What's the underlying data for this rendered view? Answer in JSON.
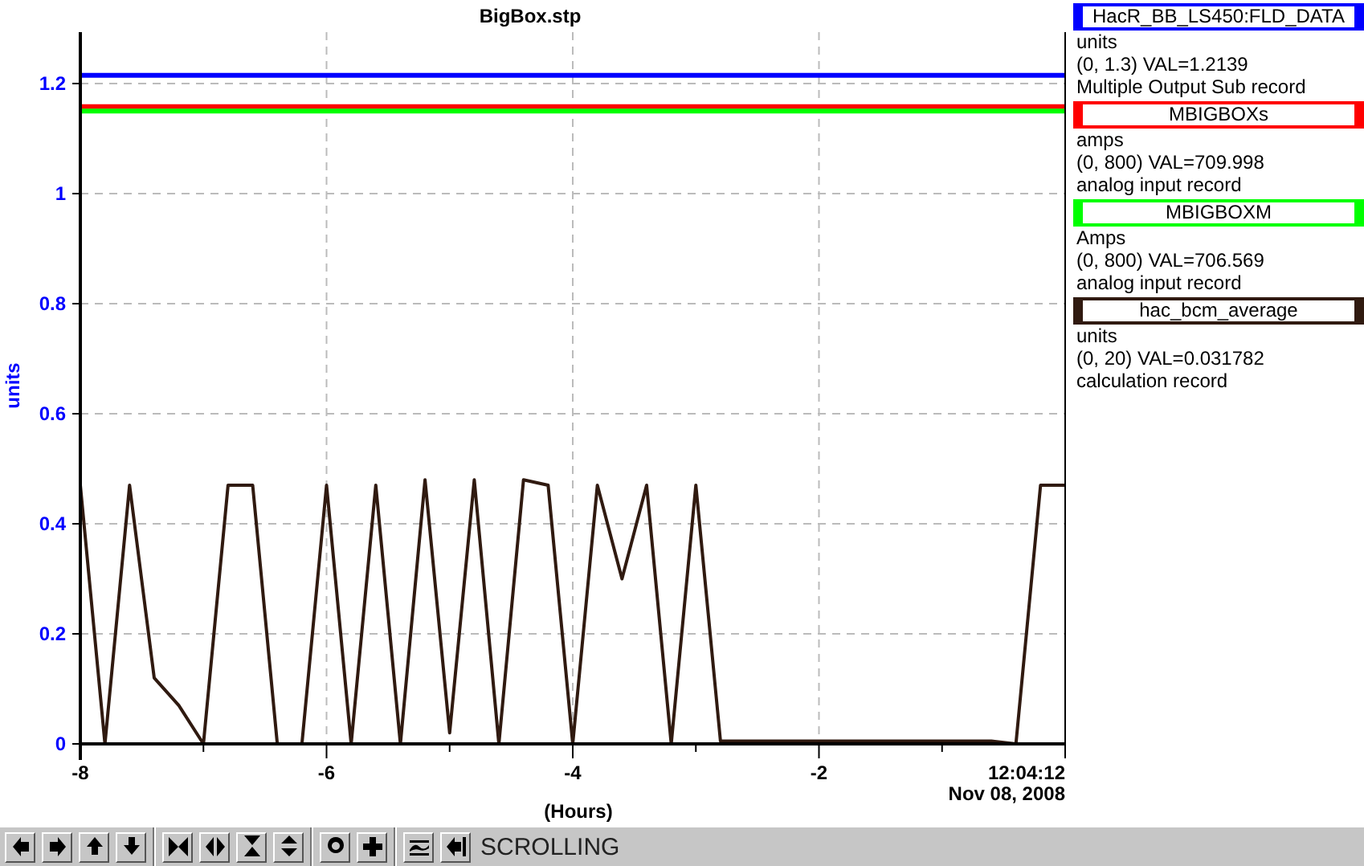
{
  "chart": {
    "chart_data": {
      "type": "line",
      "title": "BigBox.stp",
      "xlabel": "(Hours)",
      "ylabel": "units",
      "x": [
        -8,
        -7.8,
        -7.6,
        -7.4,
        -7.2,
        -7,
        -6.8,
        -6.6,
        -6.4,
        -6.2,
        -6,
        -5.8,
        -5.6,
        -5.4,
        -5.2,
        -5,
        -4.8,
        -4.6,
        -4.4,
        -4.2,
        -4,
        -3.8,
        -3.6,
        -3.4,
        -3.2,
        -3,
        -2.8,
        -2.6,
        -2.4,
        -2.2,
        -2,
        -1.8,
        -1.6,
        -1.4,
        -1.2,
        -1,
        -0.8,
        -0.6,
        -0.4,
        -0.2,
        0
      ],
      "series": [
        {
          "name": "HacR_BB_LS450:FLD_DATA",
          "color": "#0000ff",
          "values": [
            1.215,
            1.215,
            1.215,
            1.215,
            1.215,
            1.215,
            1.215,
            1.215,
            1.215,
            1.215,
            1.215,
            1.215,
            1.215,
            1.215,
            1.215,
            1.215,
            1.215,
            1.215,
            1.215,
            1.215,
            1.215,
            1.215,
            1.215,
            1.215,
            1.215,
            1.215,
            1.215,
            1.215,
            1.215,
            1.215,
            1.215,
            1.215,
            1.215,
            1.215,
            1.215,
            1.215,
            1.215,
            1.215,
            1.215,
            1.215,
            1.215
          ]
        },
        {
          "name": "MBIGBOXs",
          "color": "#ff0000",
          "values": [
            1.158,
            1.158,
            1.158,
            1.158,
            1.158,
            1.158,
            1.158,
            1.158,
            1.158,
            1.158,
            1.158,
            1.158,
            1.158,
            1.158,
            1.158,
            1.158,
            1.158,
            1.158,
            1.158,
            1.158,
            1.158,
            1.158,
            1.158,
            1.158,
            1.158,
            1.158,
            1.158,
            1.158,
            1.158,
            1.158,
            1.158,
            1.158,
            1.158,
            1.158,
            1.158,
            1.158,
            1.158,
            1.158,
            1.158,
            1.158,
            1.158
          ]
        },
        {
          "name": "MBIGBOXM",
          "color": "#00ff00",
          "values": [
            1.15,
            1.15,
            1.15,
            1.15,
            1.15,
            1.15,
            1.15,
            1.15,
            1.15,
            1.15,
            1.15,
            1.15,
            1.15,
            1.15,
            1.15,
            1.15,
            1.15,
            1.15,
            1.15,
            1.15,
            1.15,
            1.15,
            1.15,
            1.15,
            1.15,
            1.15,
            1.15,
            1.15,
            1.15,
            1.15,
            1.15,
            1.15,
            1.15,
            1.15,
            1.15,
            1.15,
            1.15,
            1.15,
            1.15,
            1.15,
            1.15
          ]
        },
        {
          "name": "hac_bcm_average",
          "color": "#301a10",
          "values": [
            0.47,
            0,
            0.47,
            0.12,
            0.07,
            0,
            0.47,
            0.47,
            0,
            0,
            0.47,
            0,
            0.47,
            0,
            0.48,
            0.02,
            0.48,
            0,
            0.48,
            0.47,
            0,
            0.47,
            0.3,
            0.47,
            0,
            0.47,
            0.005,
            0.005,
            0.005,
            0.005,
            0.005,
            0.005,
            0.005,
            0.005,
            0.005,
            0.005,
            0.005,
            0.005,
            0,
            0.47,
            0.47
          ]
        }
      ],
      "xlim": [
        -8,
        0
      ],
      "ylim": [
        0,
        1.3
      ],
      "xticks": [
        -8,
        -6,
        -4,
        -2
      ],
      "yticks": [
        0,
        0.2,
        0.4,
        0.6,
        0.8,
        1,
        1.2
      ],
      "grid": true
    },
    "end_time": "12:04:12",
    "end_date": "Nov 08, 2008"
  },
  "legend": [
    {
      "units": "units",
      "range_value": "(0, 1.3) VAL=1.2139",
      "record_type": "Multiple Output Sub record"
    },
    {
      "units": "amps",
      "range_value": "(0, 800) VAL=709.998",
      "record_type": "analog input record"
    },
    {
      "units": "Amps",
      "range_value": "(0, 800) VAL=706.569",
      "record_type": "analog input record"
    },
    {
      "units": "units",
      "range_value": "(0, 20) VAL=0.031782",
      "record_type": "calculation record"
    }
  ],
  "toolbar": {
    "mode": "SCROLLING"
  }
}
